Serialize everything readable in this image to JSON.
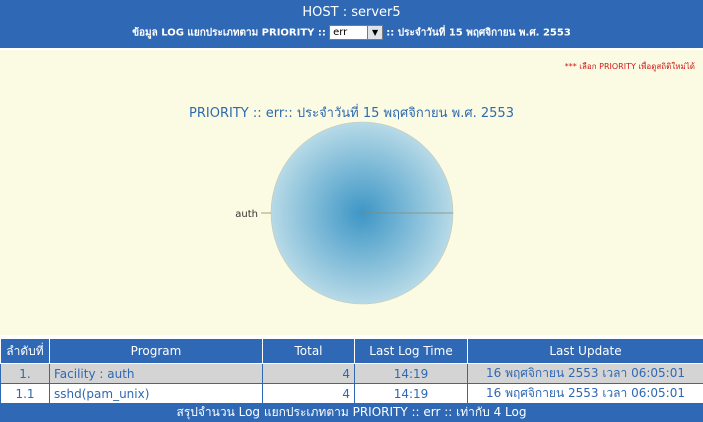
{
  "header": {
    "host_label": "HOST",
    "host_sep": ":",
    "host_name": "server5",
    "info_prefix": "ข้อมูล LOG แยกประเภทตาม PRIORITY ::",
    "priority_value": "err",
    "info_suffix": ":: ประจำวันที่ 15 พฤศจิกายน พ.ศ. 2553"
  },
  "note": "*** เลือก PRIORITY เพื่อดูสถิติใหม่ได้",
  "chart_data": {
    "type": "pie",
    "title": "PRIORITY :: err:: ประจำวันที่ 15 พฤศจิกายน พ.ศ. 2553",
    "categories": [
      "auth"
    ],
    "values": [
      4
    ]
  },
  "table": {
    "headers": [
      "ลำดับที่",
      "Program",
      "Total",
      "Last Log Time",
      "Last Update"
    ],
    "rows": [
      {
        "no": "1.",
        "program": "Facility : auth",
        "total": "4",
        "time": "14:19",
        "update": "16 พฤศจิกายน 2553 เวลา 06:05:01"
      },
      {
        "no": "1.1",
        "program": "sshd(pam_unix)",
        "total": "4",
        "time": "14:19",
        "update": "16 พฤศจิกายน 2553 เวลา 06:05:01"
      }
    ]
  },
  "footer": "สรุปจำนวน Log แยกประเภทตาม PRIORITY :: err :: เท่ากับ 4 Log",
  "colors": {
    "primary": "#2f68b4",
    "panel_bg": "#fbfbe3",
    "pie_center": "#3d96c6",
    "pie_edge": "#b7dae7"
  }
}
